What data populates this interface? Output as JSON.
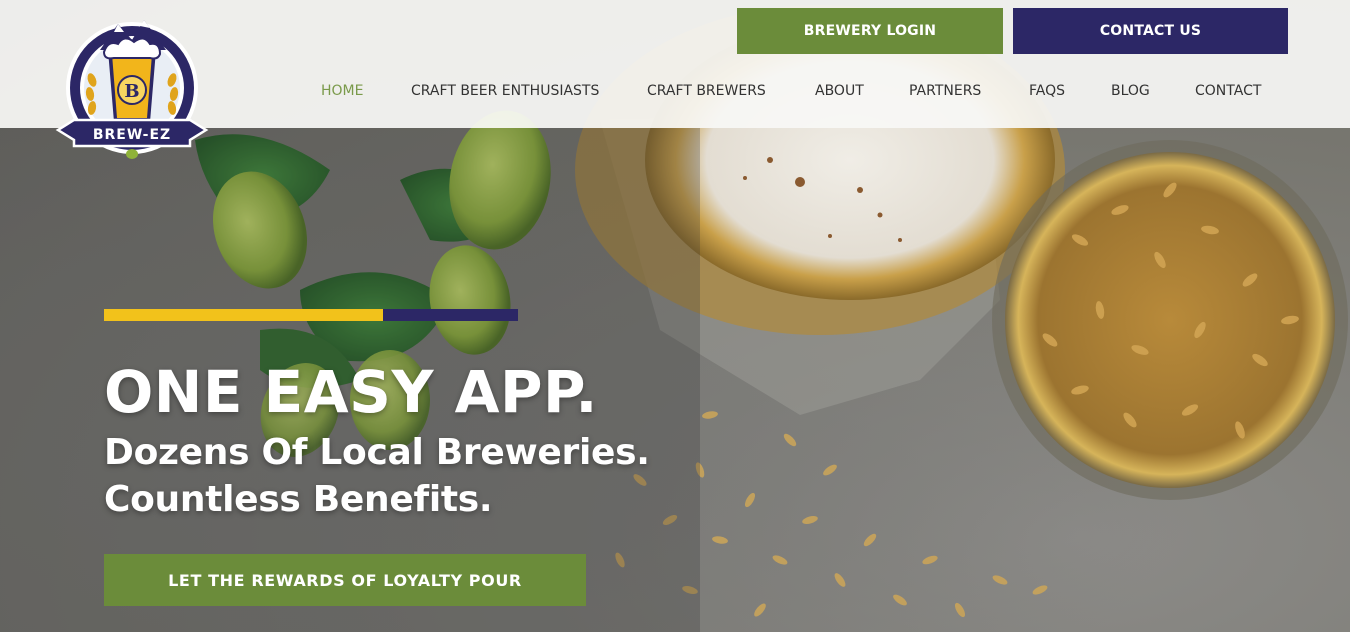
{
  "brand": {
    "logo_text": "BREW-EZ",
    "logo_letter": "B"
  },
  "header": {
    "brewery_login_label": "BREWERY LOGIN",
    "contact_us_label": "CONTACT US"
  },
  "nav": {
    "items": [
      {
        "label": "HOME",
        "active": true
      },
      {
        "label": "CRAFT BEER ENTHUSIASTS"
      },
      {
        "label": "CRAFT BREWERS"
      },
      {
        "label": "ABOUT"
      },
      {
        "label": "PARTNERS"
      },
      {
        "label": "FAQS"
      },
      {
        "label": "BLOG"
      },
      {
        "label": "CONTACT"
      }
    ]
  },
  "hero": {
    "headline": "ONE EASY APP.",
    "subline_1": "Dozens Of Local Breweries.",
    "subline_2": "Countless Benefits.",
    "cta_label": "LET THE REWARDS OF LOYALTY POUR"
  },
  "colors": {
    "green": "#6b8c3a",
    "navy": "#2c2766",
    "yellow": "#f2c21b",
    "nav_active": "#7a9a4a"
  }
}
